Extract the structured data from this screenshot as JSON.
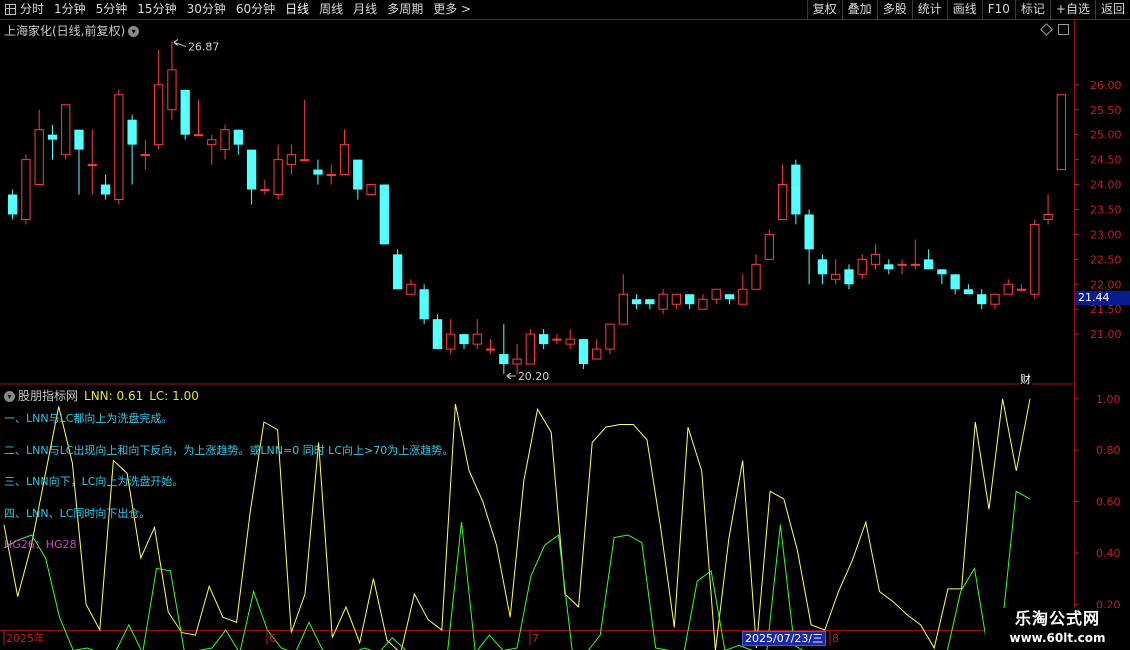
{
  "toolbar": {
    "left": [
      "分时",
      "1分钟",
      "5分钟",
      "15分钟",
      "30分钟",
      "60分钟",
      "日线",
      "周线",
      "月线",
      "多周期",
      "更多 >"
    ],
    "active": "日线",
    "right": [
      "复权",
      "叠加",
      "多股",
      "统计",
      "画线",
      "F10",
      "标记",
      "+自选",
      "返回"
    ]
  },
  "main": {
    "title": "上海家化(日线,前复权)",
    "high_label": "26.87",
    "low_label": "20.20",
    "current_price": "21.44",
    "fin_badge": "财",
    "y_ticks": [
      "26.00",
      "25.50",
      "25.00",
      "24.50",
      "24.00",
      "23.50",
      "23.00",
      "22.50",
      "22.00",
      "21.50",
      "21.00"
    ]
  },
  "indicator": {
    "name": "股朋指标网",
    "lnn_label": "LNN: 0.61",
    "lc_label": "LC: 1.00",
    "notes": [
      "一、LNN与LC都向上为洗盘完成。",
      "二、LNN与LC出现向上和向下反向，为上涨趋势。或LNN=0 同时 LC向上>70为上涨趋势。",
      "三、LNN向下，LC向上为洗盘开始。",
      "四、LNN、LC同时向下出仓。"
    ],
    "hg_note": "HG26：HG28",
    "y_ticks": [
      "1.00",
      "0.80",
      "0.60",
      "0.40",
      "0.20"
    ]
  },
  "x_axis": {
    "labels": [
      "2025年",
      "6",
      "7",
      "8"
    ],
    "cursor_date": "2025/07/23/三"
  },
  "watermark": {
    "title": "乐淘公式网",
    "url": "www.60lt.com"
  },
  "colors": {
    "up": "#ff3c3c",
    "down": "#54ffff",
    "lnn": "#ffff66",
    "lc": "#33ff33",
    "axis": "#c81e1e",
    "frame": "#9a1010"
  },
  "chart_data": [
    {
      "type": "candlestick",
      "ylim": [
        20.0,
        27.3
      ],
      "candles": [
        [
          23.8,
          23.4,
          23.9,
          23.3
        ],
        [
          23.3,
          24.5,
          24.6,
          23.2
        ],
        [
          24.0,
          25.1,
          25.5,
          24.0
        ],
        [
          25.0,
          24.9,
          25.2,
          24.5
        ],
        [
          24.6,
          25.6,
          25.6,
          24.5
        ],
        [
          25.1,
          24.7,
          25.1,
          23.8
        ],
        [
          24.4,
          24.4,
          25.1,
          23.8
        ],
        [
          24.0,
          23.8,
          24.2,
          23.7
        ],
        [
          23.7,
          25.8,
          25.9,
          23.6
        ],
        [
          25.3,
          24.8,
          25.4,
          24.0
        ],
        [
          24.6,
          24.6,
          24.9,
          24.3
        ],
        [
          24.8,
          26.0,
          26.7,
          24.7
        ],
        [
          25.5,
          26.3,
          26.87,
          25.3
        ],
        [
          25.9,
          25.0,
          25.9,
          24.9
        ],
        [
          25.0,
          25.0,
          25.7,
          25.0
        ],
        [
          24.8,
          24.9,
          25.0,
          24.4
        ],
        [
          24.7,
          25.1,
          25.2,
          24.5
        ],
        [
          25.1,
          24.8,
          25.1,
          24.6
        ],
        [
          24.7,
          23.9,
          24.7,
          23.6
        ],
        [
          23.9,
          23.9,
          24.1,
          23.8
        ],
        [
          23.8,
          24.5,
          24.8,
          23.7
        ],
        [
          24.4,
          24.6,
          24.8,
          24.2
        ],
        [
          24.5,
          24.5,
          25.7,
          24.5
        ],
        [
          24.3,
          24.2,
          24.5,
          24.0
        ],
        [
          24.2,
          24.2,
          24.4,
          24.0
        ],
        [
          24.2,
          24.8,
          25.1,
          24.2
        ],
        [
          24.5,
          23.9,
          24.5,
          23.7
        ],
        [
          23.8,
          24.0,
          24.0,
          23.8
        ],
        [
          24.0,
          22.8,
          24.0,
          22.8
        ],
        [
          22.6,
          21.9,
          22.7,
          21.9
        ],
        [
          21.8,
          22.0,
          22.1,
          21.8
        ],
        [
          21.9,
          21.3,
          22.0,
          21.2
        ],
        [
          21.3,
          20.7,
          21.4,
          20.7
        ],
        [
          20.7,
          21.0,
          21.3,
          20.6
        ],
        [
          21.0,
          20.8,
          21.0,
          20.7
        ],
        [
          20.8,
          21.0,
          21.3,
          20.7
        ],
        [
          20.7,
          20.7,
          20.9,
          20.6
        ],
        [
          20.6,
          20.4,
          21.2,
          20.2
        ],
        [
          20.4,
          20.5,
          20.8,
          20.2
        ],
        [
          20.4,
          21.0,
          21.1,
          20.4
        ],
        [
          21.0,
          20.8,
          21.1,
          20.7
        ],
        [
          20.9,
          20.9,
          21.0,
          20.8
        ],
        [
          20.8,
          20.9,
          21.1,
          20.7
        ],
        [
          20.9,
          20.4,
          20.9,
          20.3
        ],
        [
          20.5,
          20.7,
          20.9,
          20.5
        ],
        [
          20.7,
          21.2,
          21.2,
          20.6
        ],
        [
          21.2,
          21.8,
          22.2,
          21.2
        ],
        [
          21.7,
          21.6,
          21.8,
          21.5
        ],
        [
          21.7,
          21.6,
          21.7,
          21.5
        ],
        [
          21.5,
          21.8,
          21.9,
          21.4
        ],
        [
          21.6,
          21.8,
          21.8,
          21.5
        ],
        [
          21.8,
          21.6,
          21.8,
          21.5
        ],
        [
          21.5,
          21.7,
          21.8,
          21.5
        ],
        [
          21.7,
          21.9,
          21.9,
          21.6
        ],
        [
          21.8,
          21.7,
          21.8,
          21.6
        ],
        [
          21.6,
          21.9,
          22.2,
          21.6
        ],
        [
          21.9,
          22.4,
          22.6,
          21.9
        ],
        [
          22.5,
          23.0,
          23.1,
          22.5
        ],
        [
          23.3,
          24.0,
          24.4,
          23.3
        ],
        [
          24.4,
          23.4,
          24.5,
          23.2
        ],
        [
          23.4,
          22.7,
          23.5,
          22.0
        ],
        [
          22.5,
          22.2,
          22.6,
          22.0
        ],
        [
          22.1,
          22.2,
          22.5,
          22.0
        ],
        [
          22.3,
          22.0,
          22.4,
          21.9
        ],
        [
          22.2,
          22.5,
          22.6,
          22.1
        ],
        [
          22.4,
          22.6,
          22.8,
          22.3
        ],
        [
          22.4,
          22.3,
          22.5,
          22.2
        ],
        [
          22.4,
          22.4,
          22.5,
          22.2
        ],
        [
          22.4,
          22.4,
          22.9,
          22.3
        ],
        [
          22.5,
          22.3,
          22.7,
          22.3
        ],
        [
          22.3,
          22.2,
          22.3,
          22.0
        ],
        [
          22.2,
          21.9,
          22.2,
          21.8
        ],
        [
          21.9,
          21.8,
          22.0,
          21.8
        ],
        [
          21.8,
          21.6,
          21.9,
          21.5
        ],
        [
          21.6,
          21.8,
          21.8,
          21.5
        ],
        [
          21.8,
          22.0,
          22.1,
          21.8
        ],
        [
          21.9,
          21.9,
          22.0,
          21.9
        ],
        [
          21.8,
          23.2,
          23.3,
          21.7
        ],
        [
          23.3,
          23.4,
          23.8,
          23.2
        ],
        [
          24.3,
          25.8,
          25.8,
          24.3
        ]
      ]
    },
    {
      "type": "line",
      "ylim": [
        0.1,
        1.05
      ],
      "series": [
        {
          "name": "LNN",
          "values": [
            0.51,
            0.23,
            0.43,
            0.7,
            0.97,
            0.75,
            0.2,
            0.1,
            0.76,
            0.71,
            0.38,
            0.5,
            0.17,
            0.09,
            0.08,
            0.27,
            0.15,
            0.13,
            0.56,
            0.91,
            0.88,
            0.09,
            0.24,
            0.83,
            0.07,
            0.19,
            0.05,
            0.3,
            0.06,
            0.01,
            0.24,
            0.14,
            0.1,
            0.98,
            0.72,
            0.6,
            0.43,
            0.15,
            0.68,
            0.96,
            0.87,
            0.24,
            0.19,
            0.83,
            0.89,
            0.9,
            0.9,
            0.84,
            0.5,
            0.11,
            0.89,
            0.72,
            0.02,
            0.46,
            0.76,
            0.03,
            0.64,
            0.61,
            0.41,
            0.12,
            0.1,
            0.25,
            0.37,
            0.52,
            0.25,
            0.21,
            0.16,
            0.12,
            0.03,
            0.26,
            0.26,
            0.91,
            0.57,
            1.0,
            0.72,
            1.0
          ]
        },
        {
          "name": "LC",
          "values": [
            0.42,
            0.45,
            0.47,
            0.38,
            0.15,
            0.02,
            0.03,
            0.01,
            0.01,
            0.12,
            0.01,
            0.34,
            0.33,
            0.02,
            0.02,
            0.03,
            0.1,
            0.01,
            0.25,
            0.1,
            0.03,
            0.01,
            0.13,
            0.02,
            0.01,
            0.01,
            0.03,
            0.01,
            0.07,
            0.02,
            0.01,
            0.01,
            0.02,
            0.52,
            0.01,
            0.08,
            0.02,
            0.03,
            0.31,
            0.43,
            0.47,
            0.01,
            0.01,
            0.08,
            0.46,
            0.47,
            0.44,
            0.03,
            0.02,
            0.0,
            0.29,
            0.33,
            0.02,
            0.04,
            0.02,
            0.01,
            0.51,
            0.04,
            0.01,
            0.01,
            0.02,
            0.01,
            0.0,
            0.01,
            0.01,
            0.01,
            0.01,
            0.02,
            0.01,
            0.25,
            0.34,
            0.01,
            0.12,
            0.64,
            0.61
          ]
        }
      ]
    }
  ]
}
